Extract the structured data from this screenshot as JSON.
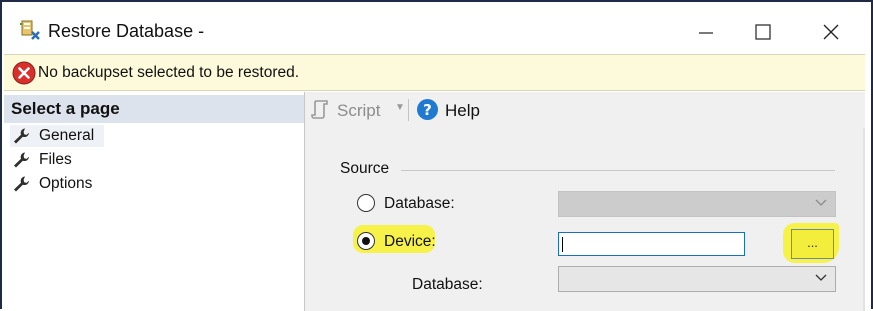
{
  "window": {
    "title": "Restore Database -",
    "icons": [
      "database-restore-icon",
      "minimize-icon",
      "maximize-icon",
      "close-icon"
    ]
  },
  "error_bar": {
    "message": "No backupset selected to be restored.",
    "icon": "error-icon",
    "icon_color": "#d9302c",
    "background": "#fdfadb"
  },
  "left_pane": {
    "header": "Select a page",
    "items": [
      {
        "label": "General",
        "icon": "wrench-icon",
        "selected": true
      },
      {
        "label": "Files",
        "icon": "wrench-icon",
        "selected": false
      },
      {
        "label": "Options",
        "icon": "wrench-icon",
        "selected": false
      }
    ]
  },
  "toolbar": {
    "script_label": "Script",
    "help_label": "Help"
  },
  "source": {
    "label": "Source",
    "database_option": {
      "label": "Database:",
      "selected": false,
      "value": ""
    },
    "device_option": {
      "label": "Device:",
      "selected": true,
      "value": "",
      "browse_label": "..."
    },
    "device_database": {
      "label": "Database:",
      "value": ""
    }
  },
  "colors": {
    "highlight": "#f7f24a",
    "focus_border": "#1a6fbf",
    "header_bg": "#dde3ec"
  }
}
